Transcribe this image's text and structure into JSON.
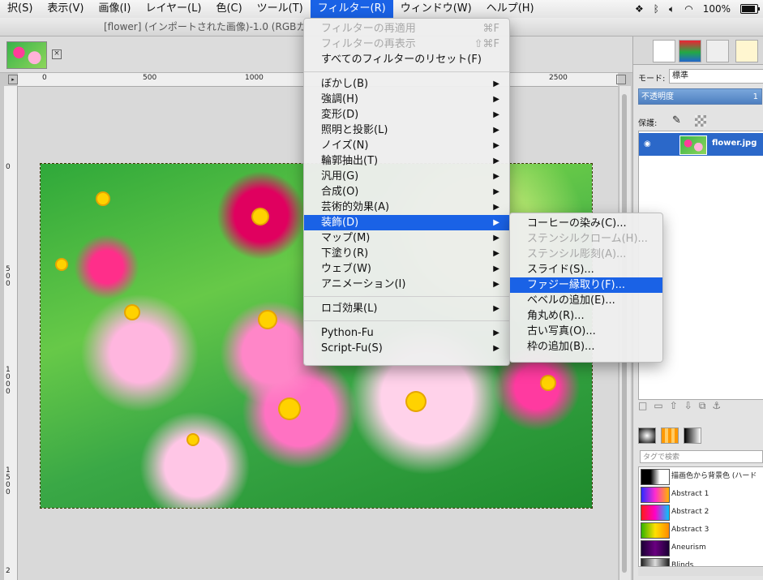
{
  "menubar": {
    "items": [
      {
        "label": "択(S)"
      },
      {
        "label": "表示(V)"
      },
      {
        "label": "画像(I)"
      },
      {
        "label": "レイヤー(L)"
      },
      {
        "label": "色(C)"
      },
      {
        "label": "ツール(T)"
      },
      {
        "label": "フィルター(R)"
      },
      {
        "label": "ウィンドウ(W)"
      },
      {
        "label": "ヘルプ(H)"
      }
    ],
    "battery": "100%"
  },
  "window": {
    "title": "[flower] (インポートされた画像)-1.0 (RGBカ"
  },
  "rulers": {
    "h_ticks": [
      "0",
      "500",
      "1000",
      "2500"
    ],
    "v_ticks": [
      "0",
      "500",
      "1000",
      "1500",
      "2"
    ]
  },
  "filters_menu": {
    "items": [
      {
        "label": "フィルターの再適用",
        "shortcut": "⌘F",
        "disabled": true
      },
      {
        "label": "フィルターの再表示",
        "shortcut": "⇧⌘F",
        "disabled": true
      },
      {
        "label": "すべてのフィルターのリセット(F)"
      },
      {
        "label": "ぼかし(B)",
        "submenu": true
      },
      {
        "label": "強調(H)",
        "submenu": true
      },
      {
        "label": "変形(D)",
        "submenu": true
      },
      {
        "label": "照明と投影(L)",
        "submenu": true
      },
      {
        "label": "ノイズ(N)",
        "submenu": true
      },
      {
        "label": "輪郭抽出(T)",
        "submenu": true
      },
      {
        "label": "汎用(G)",
        "submenu": true
      },
      {
        "label": "合成(O)",
        "submenu": true
      },
      {
        "label": "芸術的効果(A)",
        "submenu": true
      },
      {
        "label": "装飾(D)",
        "submenu": true,
        "selected": true
      },
      {
        "label": "マップ(M)",
        "submenu": true
      },
      {
        "label": "下塗り(R)",
        "submenu": true
      },
      {
        "label": "ウェブ(W)",
        "submenu": true
      },
      {
        "label": "アニメーション(I)",
        "submenu": true
      },
      {
        "label": "ロゴ効果(L)",
        "submenu": true
      },
      {
        "label": "Python-Fu",
        "submenu": true
      },
      {
        "label": "Script-Fu(S)",
        "submenu": true
      }
    ]
  },
  "decor_menu": {
    "items": [
      {
        "label": "コーヒーの染み(C)..."
      },
      {
        "label": "ステンシルクローム(H)...",
        "disabled": true
      },
      {
        "label": "ステンシル彫刻(A)...",
        "disabled": true
      },
      {
        "label": "スライド(S)..."
      },
      {
        "label": "ファジー縁取り(F)...",
        "selected": true
      },
      {
        "label": "ベベルの追加(E)..."
      },
      {
        "label": "角丸め(R)..."
      },
      {
        "label": "古い写真(O)..."
      },
      {
        "label": "枠の追加(B)..."
      }
    ]
  },
  "layers_panel": {
    "mode_label": "モード:",
    "mode_value": "標準",
    "opacity_label": "不透明度",
    "opacity_value": "1",
    "lock_label": "保護:",
    "layer_name": "flower.jpg"
  },
  "gradients_panel": {
    "tag_placeholder": "タグで検索",
    "items": [
      {
        "name": "描画色から背景色 (ハード",
        "colors": [
          "#000000",
          "#000000",
          "#ffffff",
          "#ffffff"
        ]
      },
      {
        "name": "Abstract 1",
        "colors": [
          "#2b2bff",
          "#ff2bd0",
          "#ffb400"
        ]
      },
      {
        "name": "Abstract 2",
        "colors": [
          "#ff1a1a",
          "#ff00c8",
          "#00c8ff"
        ]
      },
      {
        "name": "Abstract 3",
        "colors": [
          "#31b300",
          "#ffe000",
          "#ff8a00"
        ]
      },
      {
        "name": "Aneurism",
        "colors": [
          "#1a0033",
          "#6a0080",
          "#1a0033"
        ]
      },
      {
        "name": "Blinds",
        "colors": [
          "#222222",
          "#dddddd",
          "#222222"
        ]
      }
    ]
  },
  "colors": {
    "accent": "#1a62e6",
    "layer_selected": "#2b68c9"
  }
}
